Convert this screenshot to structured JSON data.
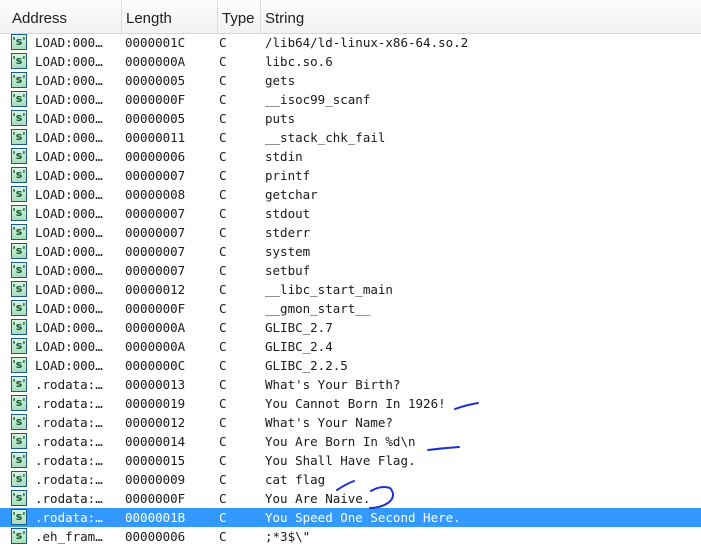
{
  "columns": {
    "address": "Address",
    "length": "Length",
    "type": "Type",
    "string": "String"
  },
  "icon": {
    "glyph": "'s'",
    "name": "string-literal-icon"
  },
  "selected_index": 25,
  "rows": [
    {
      "address": "LOAD:000…",
      "length": "0000001C",
      "type": "C",
      "string": "/lib64/ld-linux-x86-64.so.2"
    },
    {
      "address": "LOAD:000…",
      "length": "0000000A",
      "type": "C",
      "string": "libc.so.6"
    },
    {
      "address": "LOAD:000…",
      "length": "00000005",
      "type": "C",
      "string": "gets"
    },
    {
      "address": "LOAD:000…",
      "length": "0000000F",
      "type": "C",
      "string": "__isoc99_scanf"
    },
    {
      "address": "LOAD:000…",
      "length": "00000005",
      "type": "C",
      "string": "puts"
    },
    {
      "address": "LOAD:000…",
      "length": "00000011",
      "type": "C",
      "string": "__stack_chk_fail"
    },
    {
      "address": "LOAD:000…",
      "length": "00000006",
      "type": "C",
      "string": "stdin"
    },
    {
      "address": "LOAD:000…",
      "length": "00000007",
      "type": "C",
      "string": "printf"
    },
    {
      "address": "LOAD:000…",
      "length": "00000008",
      "type": "C",
      "string": "getchar"
    },
    {
      "address": "LOAD:000…",
      "length": "00000007",
      "type": "C",
      "string": "stdout"
    },
    {
      "address": "LOAD:000…",
      "length": "00000007",
      "type": "C",
      "string": "stderr"
    },
    {
      "address": "LOAD:000…",
      "length": "00000007",
      "type": "C",
      "string": "system"
    },
    {
      "address": "LOAD:000…",
      "length": "00000007",
      "type": "C",
      "string": "setbuf"
    },
    {
      "address": "LOAD:000…",
      "length": "00000012",
      "type": "C",
      "string": "__libc_start_main"
    },
    {
      "address": "LOAD:000…",
      "length": "0000000F",
      "type": "C",
      "string": "__gmon_start__"
    },
    {
      "address": "LOAD:000…",
      "length": "0000000A",
      "type": "C",
      "string": "GLIBC_2.7"
    },
    {
      "address": "LOAD:000…",
      "length": "0000000A",
      "type": "C",
      "string": "GLIBC_2.4"
    },
    {
      "address": "LOAD:000…",
      "length": "0000000C",
      "type": "C",
      "string": "GLIBC_2.2.5"
    },
    {
      "address": ".rodata:…",
      "length": "00000013",
      "type": "C",
      "string": "What's Your Birth?"
    },
    {
      "address": ".rodata:…",
      "length": "00000019",
      "type": "C",
      "string": "You Cannot Born In 1926!"
    },
    {
      "address": ".rodata:…",
      "length": "00000012",
      "type": "C",
      "string": "What's Your Name?"
    },
    {
      "address": ".rodata:…",
      "length": "00000014",
      "type": "C",
      "string": "You Are Born In %d\\n"
    },
    {
      "address": ".rodata:…",
      "length": "00000015",
      "type": "C",
      "string": "You Shall Have Flag."
    },
    {
      "address": ".rodata:…",
      "length": "00000009",
      "type": "C",
      "string": "cat flag"
    },
    {
      "address": ".rodata:…",
      "length": "0000000F",
      "type": "C",
      "string": "You Are Naive."
    },
    {
      "address": ".rodata:…",
      "length": "0000001B",
      "type": "C",
      "string": "You Speed One Second Here."
    },
    {
      "address": ".eh_fram…",
      "length": "00000006",
      "type": "C",
      "string": ";*3$\\\""
    }
  ],
  "colors": {
    "selection": "#3399ff",
    "annotation": "#1f2fd6"
  }
}
